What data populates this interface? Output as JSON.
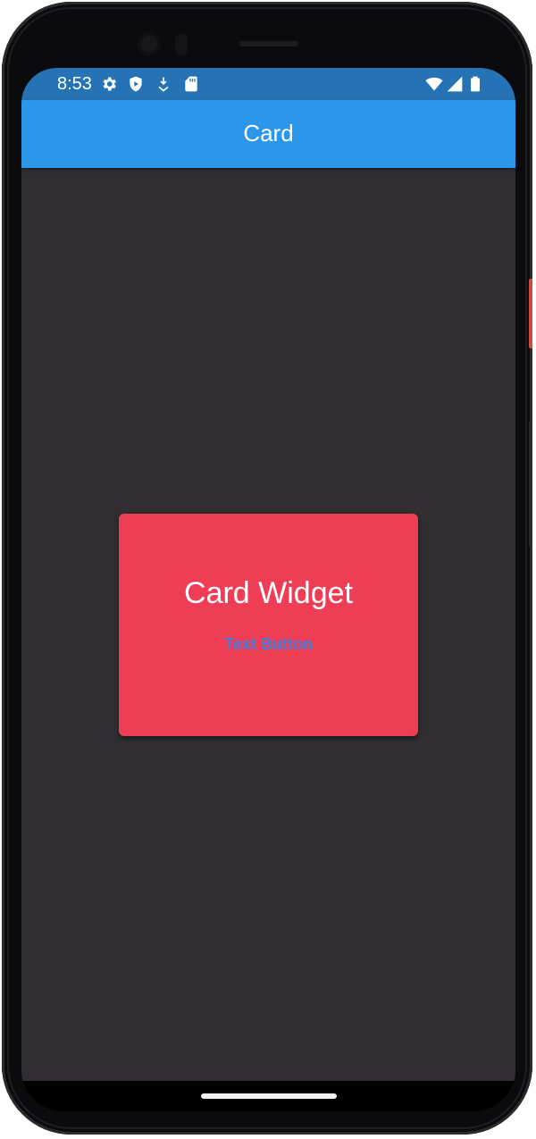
{
  "status_bar": {
    "time": "8:53",
    "left_icons": [
      "gear-icon",
      "shield-icon",
      "download-icon",
      "sd-card-icon"
    ],
    "right_icons": [
      "wifi-icon",
      "cell-signal-icon",
      "battery-icon"
    ],
    "color": "#2573b4"
  },
  "app_bar": {
    "title": "Card",
    "color": "#2c97ea"
  },
  "body": {
    "background": "#302e31",
    "card": {
      "title": "Card Widget",
      "button_label": "Text Button",
      "color": "#ef3d56",
      "button_color": "#3e7fe0"
    }
  }
}
